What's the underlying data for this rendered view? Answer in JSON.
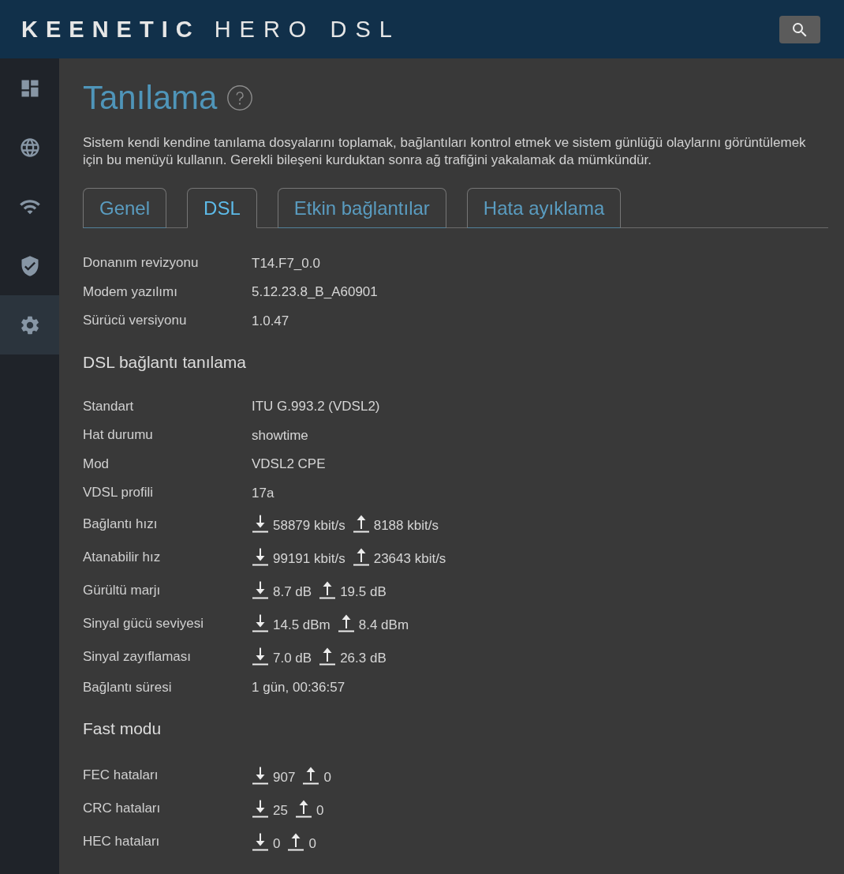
{
  "header": {
    "brand": "KEENETIC",
    "model": "HERO DSL"
  },
  "sidebar": {
    "items": [
      {
        "kind": "dashboard",
        "selected": false
      },
      {
        "kind": "globe",
        "selected": false
      },
      {
        "kind": "wifi",
        "selected": false
      },
      {
        "kind": "shield",
        "selected": false
      },
      {
        "kind": "settings",
        "selected": true
      }
    ]
  },
  "page": {
    "title": "Tanılama",
    "description": "Sistem kendi kendine tanılama dosyalarını toplamak, bağlantıları kontrol etmek ve sistem günlüğü olaylarını görüntülemek için bu menüyü kullanın. Gerekli bileşeni kurduktan sonra ağ trafiğini yakalamak da mümkündür."
  },
  "tabs": [
    {
      "label": "Genel",
      "selected": false
    },
    {
      "label": "DSL",
      "selected": true
    },
    {
      "label": "Etkin bağlantılar",
      "selected": false
    },
    {
      "label": "Hata ayıklama",
      "selected": false
    }
  ],
  "info_rows": [
    {
      "kind": "text",
      "label": "Donanım revizyonu",
      "value": "T14.F7_0.0"
    },
    {
      "kind": "text",
      "label": "Modem yazılımı",
      "value": "5.12.23.8_B_A60901"
    },
    {
      "kind": "text",
      "label": "Sürücü versiyonu",
      "value": "1.0.47"
    }
  ],
  "sections": [
    {
      "heading": "DSL bağlantı tanılama",
      "rows": [
        {
          "kind": "text",
          "label": "Standart",
          "value": "ITU G.993.2 (VDSL2)"
        },
        {
          "kind": "text",
          "label": "Hat durumu",
          "value": "showtime"
        },
        {
          "kind": "text",
          "label": "Mod",
          "value": "VDSL2 CPE"
        },
        {
          "kind": "text",
          "label": "VDSL profili",
          "value": "17a"
        },
        {
          "kind": "rate",
          "label": "Bağlantı hızı",
          "down": "58879 kbit/s",
          "up": "8188 kbit/s"
        },
        {
          "kind": "rate",
          "label": "Atanabilir hız",
          "down": "99191 kbit/s",
          "up": "23643 kbit/s"
        },
        {
          "kind": "rate",
          "label": "Gürültü marjı",
          "down": "8.7 dB",
          "up": "19.5 dB"
        },
        {
          "kind": "rate",
          "label": "Sinyal gücü seviyesi",
          "down": "14.5 dBm",
          "up": "8.4 dBm"
        },
        {
          "kind": "rate",
          "label": "Sinyal zayıflaması",
          "down": "7.0 dB",
          "up": "26.3 dB"
        },
        {
          "kind": "text",
          "label": "Bağlantı süresi",
          "value": "1 gün, 00:36:57"
        }
      ]
    },
    {
      "heading": "Fast modu",
      "rows": [
        {
          "kind": "rate",
          "label": "FEC hataları",
          "down": "907",
          "up": "0"
        },
        {
          "kind": "rate",
          "label": "CRC hataları",
          "down": "25",
          "up": "0"
        },
        {
          "kind": "rate",
          "label": "HEC hataları",
          "down": "0",
          "up": "0"
        }
      ]
    }
  ]
}
